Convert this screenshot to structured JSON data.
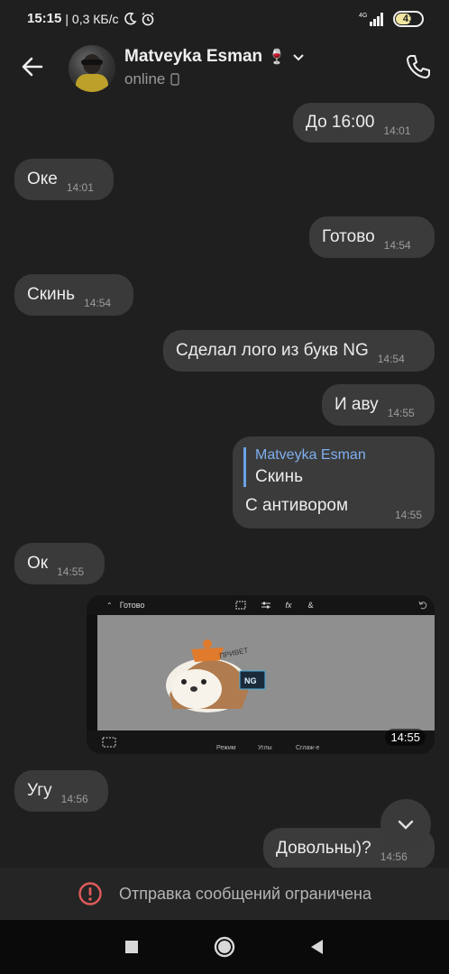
{
  "status_bar": {
    "time": "15:15",
    "network_speed": "| 0,3 КБ/с",
    "signal_label": "4G",
    "battery": "41"
  },
  "header": {
    "contact_name": "Matveyka Esman",
    "name_emoji": "🍷",
    "status": "online"
  },
  "messages": [
    {
      "direction": "out",
      "text": "До 16:00",
      "time": "14:01"
    },
    {
      "direction": "in",
      "text": "Оке",
      "time": "14:01"
    },
    {
      "direction": "out",
      "text": "Готово",
      "time": "14:54"
    },
    {
      "direction": "in",
      "text": "Скинь",
      "time": "14:54"
    },
    {
      "direction": "out",
      "text": "Сделал лого из букв NG",
      "time": "14:54"
    },
    {
      "direction": "out",
      "text": "И аву",
      "time": "14:55"
    },
    {
      "direction": "out",
      "reply_to_author": "Matveyka Esman",
      "reply_to_text": "Скинь",
      "text": "С антивором",
      "time": "14:55"
    },
    {
      "direction": "in",
      "text": "Ок",
      "time": "14:55"
    },
    {
      "direction": "out",
      "type": "image",
      "time": "14:55",
      "image_content": {
        "top_label": "Готово",
        "sticker_text": "ПРИВЕТ",
        "logo_text": "NG",
        "bottom_labels": [
          "Режим",
          "Углы",
          "Сглаж-е"
        ]
      }
    },
    {
      "direction": "in",
      "text": "Угу",
      "time": "14:56"
    },
    {
      "direction": "out",
      "text": "Довольны)?",
      "time": "14:56"
    }
  ],
  "restricted_notice": "Отправка сообщений ограничена",
  "icons": {
    "back": "arrow-left-icon",
    "phone": "phone-icon",
    "chevron": "chevron-down-icon",
    "alert": "alert-circle-icon",
    "scroll": "scroll-down-icon"
  },
  "colors": {
    "background": "#1f1f1f",
    "bubble": "#3a3a3a",
    "reply_accent": "#6aa3e8",
    "alert": "#e05a5a"
  }
}
